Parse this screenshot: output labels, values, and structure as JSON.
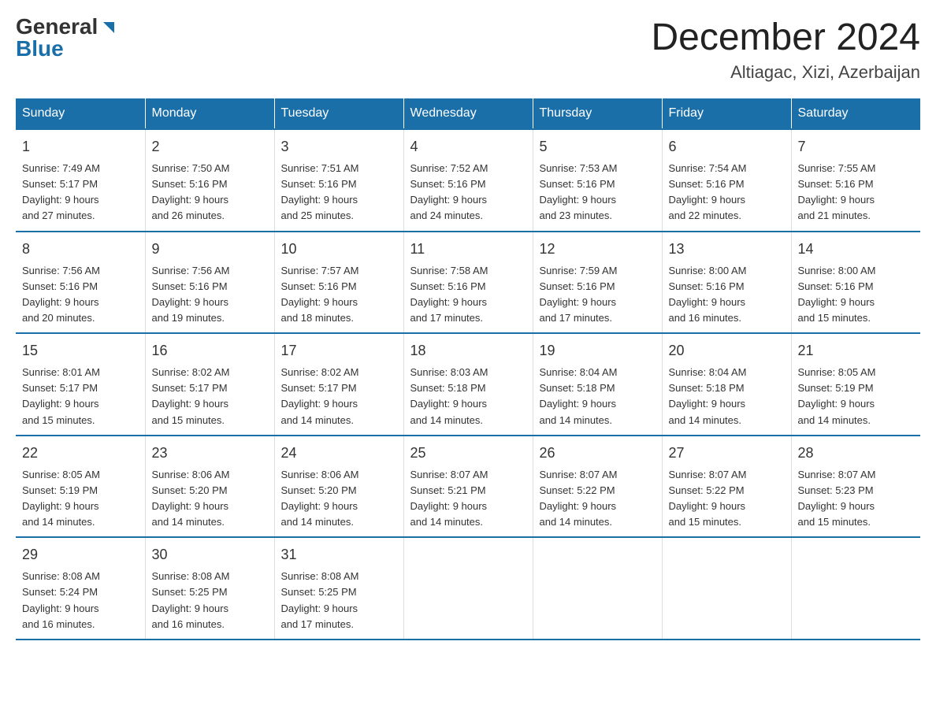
{
  "logo": {
    "general": "General",
    "blue": "Blue",
    "triangle": "▶"
  },
  "title": "December 2024",
  "location": "Altiagac, Xizi, Azerbaijan",
  "headers": [
    "Sunday",
    "Monday",
    "Tuesday",
    "Wednesday",
    "Thursday",
    "Friday",
    "Saturday"
  ],
  "weeks": [
    [
      {
        "day": "1",
        "sunrise": "7:49 AM",
        "sunset": "5:17 PM",
        "daylight": "9 hours and 27 minutes."
      },
      {
        "day": "2",
        "sunrise": "7:50 AM",
        "sunset": "5:16 PM",
        "daylight": "9 hours and 26 minutes."
      },
      {
        "day": "3",
        "sunrise": "7:51 AM",
        "sunset": "5:16 PM",
        "daylight": "9 hours and 25 minutes."
      },
      {
        "day": "4",
        "sunrise": "7:52 AM",
        "sunset": "5:16 PM",
        "daylight": "9 hours and 24 minutes."
      },
      {
        "day": "5",
        "sunrise": "7:53 AM",
        "sunset": "5:16 PM",
        "daylight": "9 hours and 23 minutes."
      },
      {
        "day": "6",
        "sunrise": "7:54 AM",
        "sunset": "5:16 PM",
        "daylight": "9 hours and 22 minutes."
      },
      {
        "day": "7",
        "sunrise": "7:55 AM",
        "sunset": "5:16 PM",
        "daylight": "9 hours and 21 minutes."
      }
    ],
    [
      {
        "day": "8",
        "sunrise": "7:56 AM",
        "sunset": "5:16 PM",
        "daylight": "9 hours and 20 minutes."
      },
      {
        "day": "9",
        "sunrise": "7:56 AM",
        "sunset": "5:16 PM",
        "daylight": "9 hours and 19 minutes."
      },
      {
        "day": "10",
        "sunrise": "7:57 AM",
        "sunset": "5:16 PM",
        "daylight": "9 hours and 18 minutes."
      },
      {
        "day": "11",
        "sunrise": "7:58 AM",
        "sunset": "5:16 PM",
        "daylight": "9 hours and 17 minutes."
      },
      {
        "day": "12",
        "sunrise": "7:59 AM",
        "sunset": "5:16 PM",
        "daylight": "9 hours and 17 minutes."
      },
      {
        "day": "13",
        "sunrise": "8:00 AM",
        "sunset": "5:16 PM",
        "daylight": "9 hours and 16 minutes."
      },
      {
        "day": "14",
        "sunrise": "8:00 AM",
        "sunset": "5:16 PM",
        "daylight": "9 hours and 15 minutes."
      }
    ],
    [
      {
        "day": "15",
        "sunrise": "8:01 AM",
        "sunset": "5:17 PM",
        "daylight": "9 hours and 15 minutes."
      },
      {
        "day": "16",
        "sunrise": "8:02 AM",
        "sunset": "5:17 PM",
        "daylight": "9 hours and 15 minutes."
      },
      {
        "day": "17",
        "sunrise": "8:02 AM",
        "sunset": "5:17 PM",
        "daylight": "9 hours and 14 minutes."
      },
      {
        "day": "18",
        "sunrise": "8:03 AM",
        "sunset": "5:18 PM",
        "daylight": "9 hours and 14 minutes."
      },
      {
        "day": "19",
        "sunrise": "8:04 AM",
        "sunset": "5:18 PM",
        "daylight": "9 hours and 14 minutes."
      },
      {
        "day": "20",
        "sunrise": "8:04 AM",
        "sunset": "5:18 PM",
        "daylight": "9 hours and 14 minutes."
      },
      {
        "day": "21",
        "sunrise": "8:05 AM",
        "sunset": "5:19 PM",
        "daylight": "9 hours and 14 minutes."
      }
    ],
    [
      {
        "day": "22",
        "sunrise": "8:05 AM",
        "sunset": "5:19 PM",
        "daylight": "9 hours and 14 minutes."
      },
      {
        "day": "23",
        "sunrise": "8:06 AM",
        "sunset": "5:20 PM",
        "daylight": "9 hours and 14 minutes."
      },
      {
        "day": "24",
        "sunrise": "8:06 AM",
        "sunset": "5:20 PM",
        "daylight": "9 hours and 14 minutes."
      },
      {
        "day": "25",
        "sunrise": "8:07 AM",
        "sunset": "5:21 PM",
        "daylight": "9 hours and 14 minutes."
      },
      {
        "day": "26",
        "sunrise": "8:07 AM",
        "sunset": "5:22 PM",
        "daylight": "9 hours and 14 minutes."
      },
      {
        "day": "27",
        "sunrise": "8:07 AM",
        "sunset": "5:22 PM",
        "daylight": "9 hours and 15 minutes."
      },
      {
        "day": "28",
        "sunrise": "8:07 AM",
        "sunset": "5:23 PM",
        "daylight": "9 hours and 15 minutes."
      }
    ],
    [
      {
        "day": "29",
        "sunrise": "8:08 AM",
        "sunset": "5:24 PM",
        "daylight": "9 hours and 16 minutes."
      },
      {
        "day": "30",
        "sunrise": "8:08 AM",
        "sunset": "5:25 PM",
        "daylight": "9 hours and 16 minutes."
      },
      {
        "day": "31",
        "sunrise": "8:08 AM",
        "sunset": "5:25 PM",
        "daylight": "9 hours and 17 minutes."
      },
      null,
      null,
      null,
      null
    ]
  ],
  "labels": {
    "sunrise": "Sunrise:",
    "sunset": "Sunset:",
    "daylight": "Daylight:"
  }
}
